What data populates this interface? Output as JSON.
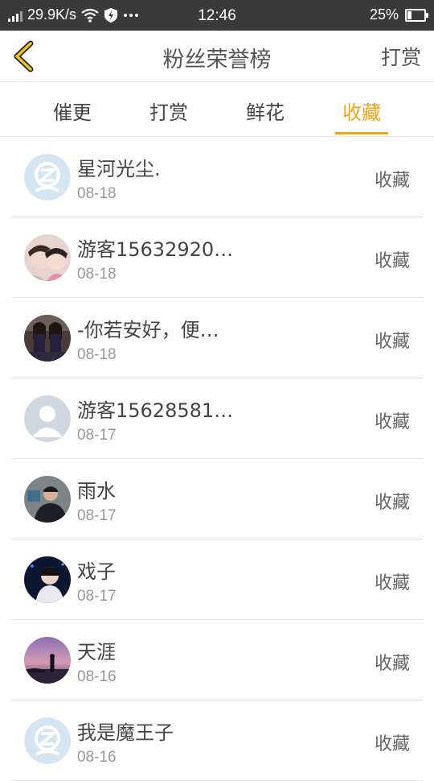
{
  "status_bar": {
    "speed": "29.9K/s",
    "time": "12:46",
    "battery_percent": "25%",
    "battery_level": 0.25,
    "icons": [
      "signal-icon",
      "wifi-icon",
      "shield-icon",
      "more-dots-icon",
      "battery-icon"
    ]
  },
  "header": {
    "back_icon": "chevron-left-icon",
    "title": "粉丝荣誉榜",
    "action": "打赏"
  },
  "colors": {
    "accent": "#f2a312",
    "status_bar_bg": "#3a3a3a"
  },
  "tabs": [
    {
      "label": "催更",
      "active": false
    },
    {
      "label": "打赏",
      "active": false
    },
    {
      "label": "鲜花",
      "active": false
    },
    {
      "label": "收藏",
      "active": true
    }
  ],
  "items": [
    {
      "name": "星河光尘.",
      "date": "08-18",
      "action": "收藏",
      "avatar": "qq-default-avatar"
    },
    {
      "name": "游客15632920…",
      "date": "08-18",
      "action": "收藏",
      "avatar": "user-photo-avatar"
    },
    {
      "name": "-你若安好，便…",
      "date": "08-18",
      "action": "收藏",
      "avatar": "user-photo-avatar"
    },
    {
      "name": "游客15628581…",
      "date": "08-17",
      "action": "收藏",
      "avatar": "default-person-avatar"
    },
    {
      "name": "雨水",
      "date": "08-17",
      "action": "收藏",
      "avatar": "user-photo-avatar"
    },
    {
      "name": "戏子",
      "date": "08-17",
      "action": "收藏",
      "avatar": "user-photo-avatar"
    },
    {
      "name": "天涯",
      "date": "08-16",
      "action": "收藏",
      "avatar": "user-photo-avatar"
    },
    {
      "name": "我是魔王子",
      "date": "08-16",
      "action": "收藏",
      "avatar": "qq-default-avatar"
    }
  ]
}
